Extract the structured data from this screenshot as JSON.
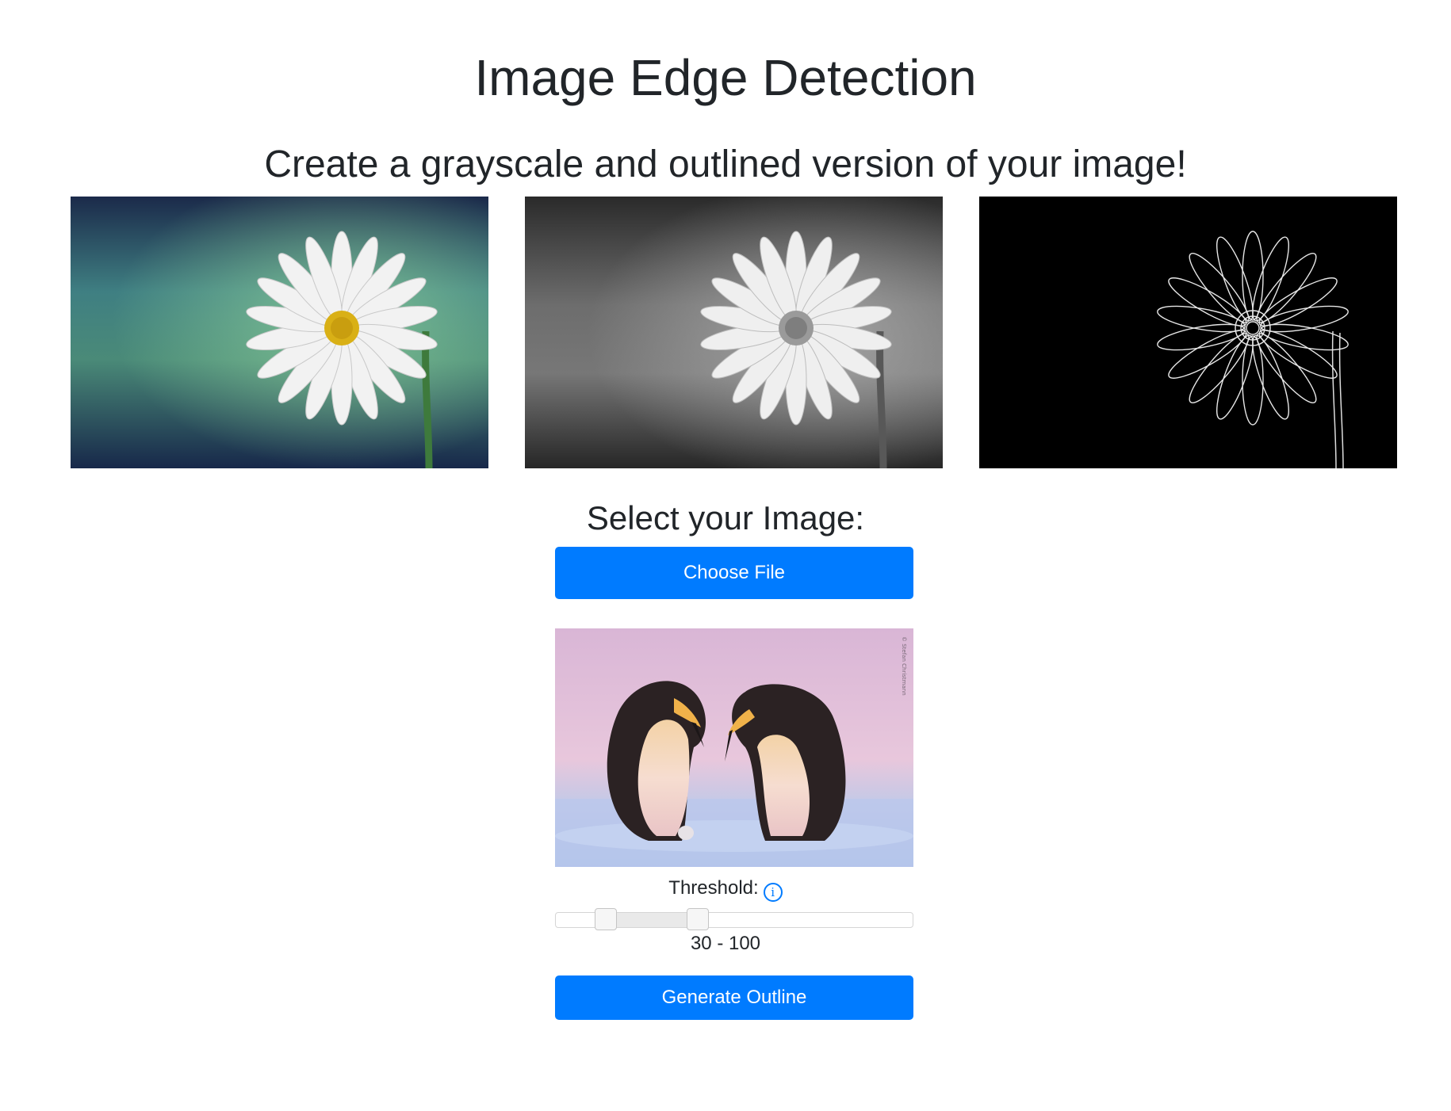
{
  "page": {
    "title": "Image Edge Detection",
    "subtitle": "Create a grayscale and outlined version of your image!"
  },
  "gallery": {
    "images": [
      {
        "name": "original-daisy-image",
        "kind": "color photo"
      },
      {
        "name": "grayscale-daisy-image",
        "kind": "grayscale photo"
      },
      {
        "name": "outline-daisy-image",
        "kind": "edge outline"
      }
    ]
  },
  "upload": {
    "heading": "Select your Image:",
    "choose_file_label": "Choose File"
  },
  "preview": {
    "description": "penguins photo",
    "watermark": "© Stefan Christmann"
  },
  "threshold": {
    "label": "Threshold:",
    "info_icon": "info-icon",
    "min": 0,
    "max": 255,
    "low": 30,
    "high": 100,
    "value_text": "30 - 100"
  },
  "actions": {
    "generate_label": "Generate Outline"
  },
  "colors": {
    "accent": "#007bff",
    "text": "#212529"
  }
}
